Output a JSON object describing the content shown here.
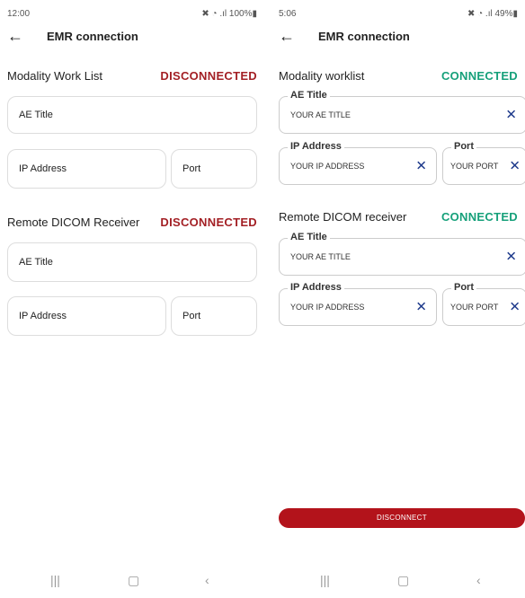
{
  "left": {
    "status": {
      "time": "12:00",
      "icons": "✖ ◔ .ıl 100%▮"
    },
    "title": "EMR connection",
    "section1": {
      "label": "Modality Work List",
      "status": "DISCONNECTED"
    },
    "section2": {
      "label": "Remote DICOM Receiver",
      "status": "DISCONNECTED"
    },
    "fields": {
      "ae_title": "AE Title",
      "ip": "IP Address",
      "port": "Port"
    }
  },
  "right": {
    "status": {
      "time": "5:06",
      "icons": "✖ ◔ .ıl 49%▮"
    },
    "title": "EMR connection",
    "section1": {
      "label": "Modality worklist",
      "status": "CONNECTED"
    },
    "section2": {
      "label": "Remote DICOM receiver",
      "status": "CONNECTED"
    },
    "fields": {
      "ae_title": "AE Title",
      "ip": "IP Address",
      "port": "Port"
    },
    "values": {
      "ae_title": "YOUR AE TITLE",
      "ip": "YOUR IP ADDRESS",
      "port": "YOUR PORT"
    },
    "button": "DISCONNECT"
  },
  "colors": {
    "disconnected": "#a32025",
    "connected": "#16a07a",
    "button": "#b3131b",
    "clear_icon": "#1f3b8c"
  },
  "icons": {
    "back": "←",
    "clear": "✕",
    "nav_recent": "|||",
    "nav_home": "▢",
    "nav_back": "‹"
  }
}
